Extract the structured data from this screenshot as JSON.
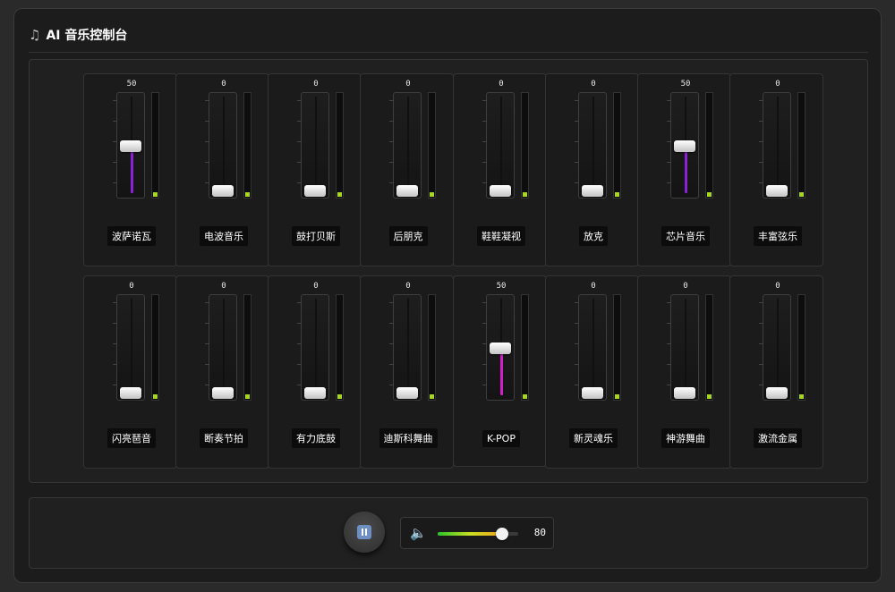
{
  "app": {
    "title": "AI 音乐控制台",
    "title_icon": "music-note-icon"
  },
  "colors": {
    "fill_default": "#8a20d8",
    "fill_kpop": "#d01ec8",
    "meter_level": "#a6d61f"
  },
  "channels": [
    {
      "label": "波萨诺瓦",
      "value": "50"
    },
    {
      "label": "电波音乐",
      "value": "0"
    },
    {
      "label": "鼓打贝斯",
      "value": "0"
    },
    {
      "label": "后朋克",
      "value": "0"
    },
    {
      "label": "鞋鞋凝视",
      "value": "0"
    },
    {
      "label": "放克",
      "value": "0"
    },
    {
      "label": "芯片音乐",
      "value": "50"
    },
    {
      "label": "丰富弦乐",
      "value": "0"
    },
    {
      "label": "闪亮琶音",
      "value": "0"
    },
    {
      "label": "断奏节拍",
      "value": "0"
    },
    {
      "label": "有力底鼓",
      "value": "0"
    },
    {
      "label": "迪斯科舞曲",
      "value": "0"
    },
    {
      "label": "K-POP",
      "value": "50"
    },
    {
      "label": "新灵魂乐",
      "value": "0"
    },
    {
      "label": "神游舞曲",
      "value": "0"
    },
    {
      "label": "激流金属",
      "value": "0"
    }
  ],
  "transport": {
    "play_pause_icon": "pause-icon",
    "volume_icon": "speaker-icon",
    "volume": "80",
    "volume_max": 100
  }
}
